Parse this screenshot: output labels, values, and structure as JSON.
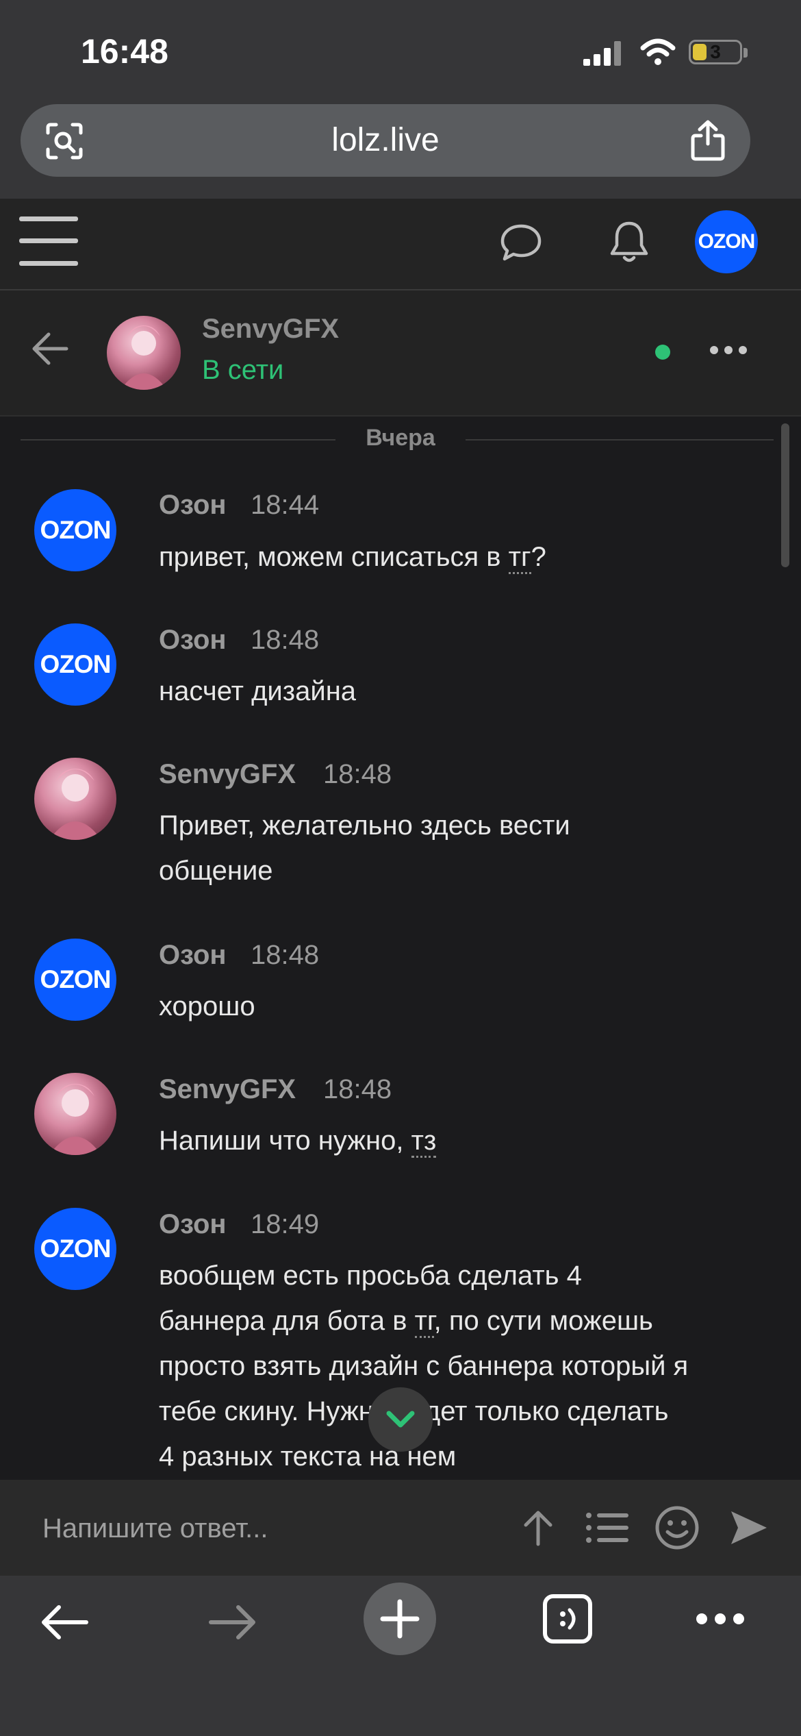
{
  "status_bar": {
    "time": "16:48",
    "battery_level": "3"
  },
  "browser": {
    "url": "lolz.live"
  },
  "chat": {
    "contact_name": "SenvyGFX",
    "contact_status": "В сети",
    "day_divider": "Вчера"
  },
  "brand": {
    "ozon_logo": "OZON",
    "ozon_color": "#0a5bff",
    "online_color": "#2ec276"
  },
  "messages": [
    {
      "author": "Озон",
      "time": "18:44",
      "text_before": "привет, можем списаться в ",
      "highlight": "тг",
      "text_after": "?"
    },
    {
      "author": "Озон",
      "time": "18:48",
      "text": "насчет дизайна"
    },
    {
      "author": "SenvyGFX",
      "time": "18:48",
      "line1": "Привет, желательно здесь вести",
      "line2": "общение"
    },
    {
      "author": "Озон",
      "time": "18:48",
      "text": "хорошо"
    },
    {
      "author": "SenvyGFX",
      "time": "18:48",
      "text_before": "Напиши что нужно, ",
      "highlight": "тз"
    },
    {
      "author": "Озон",
      "time": "18:49",
      "line1": "вообщем есть просьба сделать 4",
      "line2_before": "баннера для бота в ",
      "line2_highlight": "тг",
      "line2_after": ", по сути можешь",
      "line3": "просто взять дизайн с баннера который я",
      "line4": "тебе скину. Нужно будет только сделать",
      "line5": "4 разных текста на нем"
    }
  ],
  "composer": {
    "placeholder": "Напишите ответ..."
  }
}
